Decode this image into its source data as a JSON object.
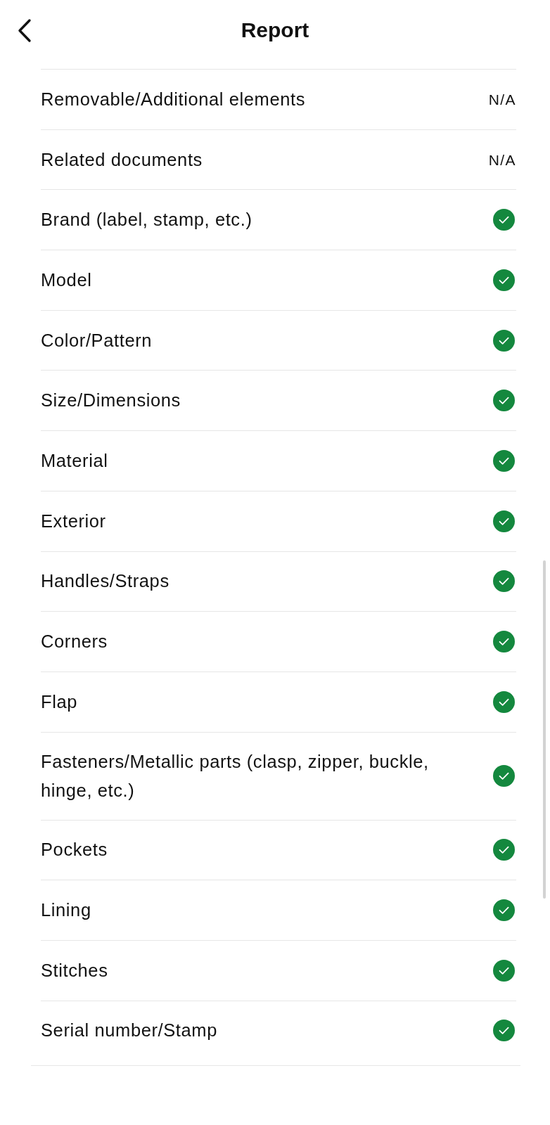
{
  "header": {
    "title": "Report"
  },
  "items": [
    {
      "label": "Removable/Additional elements",
      "kind": "value",
      "value": "N/A"
    },
    {
      "label": "Related documents",
      "kind": "value",
      "value": "N/A"
    },
    {
      "label": "Brand (label, stamp, etc.)",
      "kind": "check"
    },
    {
      "label": "Model",
      "kind": "check"
    },
    {
      "label": "Color/Pattern",
      "kind": "check"
    },
    {
      "label": "Size/Dimensions",
      "kind": "check"
    },
    {
      "label": "Material",
      "kind": "check"
    },
    {
      "label": "Exterior",
      "kind": "check"
    },
    {
      "label": "Handles/Straps",
      "kind": "check"
    },
    {
      "label": "Corners",
      "kind": "check"
    },
    {
      "label": "Flap",
      "kind": "check"
    },
    {
      "label": "Fasteners/Metallic parts (clasp, zipper, buckle, hinge, etc.)",
      "kind": "check"
    },
    {
      "label": "Pockets",
      "kind": "check"
    },
    {
      "label": "Lining",
      "kind": "check"
    },
    {
      "label": "Stitches",
      "kind": "check"
    },
    {
      "label": "Serial number/Stamp",
      "kind": "check"
    }
  ]
}
